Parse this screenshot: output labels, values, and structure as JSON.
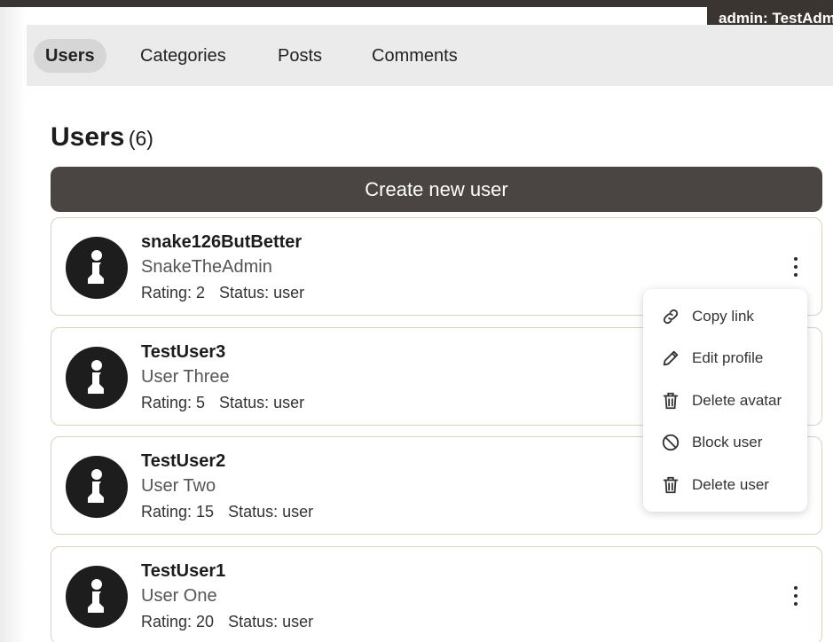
{
  "header": {
    "admin_badge": "admin: TestAdmin"
  },
  "tabs": [
    {
      "label": "Users",
      "active": true
    },
    {
      "label": "Categories",
      "active": false
    },
    {
      "label": "Posts",
      "active": false
    },
    {
      "label": "Comments",
      "active": false
    }
  ],
  "page": {
    "title": "Users",
    "count": "(6)",
    "create_button": "Create new user"
  },
  "users": [
    {
      "username": "snake126ButBetter",
      "display_name": "SnakeTheAdmin",
      "rating": "Rating: 2",
      "status": "Status: user"
    },
    {
      "username": "TestUser3",
      "display_name": "User Three",
      "rating": "Rating: 5",
      "status": "Status: user"
    },
    {
      "username": "TestUser2",
      "display_name": "User Two",
      "rating": "Rating: 15",
      "status": "Status: user"
    },
    {
      "username": "TestUser1",
      "display_name": "User One",
      "rating": "Rating: 20",
      "status": "Status: user"
    }
  ],
  "context_menu": {
    "items": [
      {
        "label": "Copy link",
        "icon": "link-icon"
      },
      {
        "label": "Edit profile",
        "icon": "pencil-icon"
      },
      {
        "label": "Delete avatar",
        "icon": "trash-icon"
      },
      {
        "label": "Block user",
        "icon": "block-icon"
      },
      {
        "label": "Delete user",
        "icon": "trash-icon"
      }
    ]
  },
  "colors": {
    "dark": "#3b3532",
    "button": "#4a4542",
    "card_border": "#ddd0bf",
    "tab_bar": "#ebebeb"
  }
}
